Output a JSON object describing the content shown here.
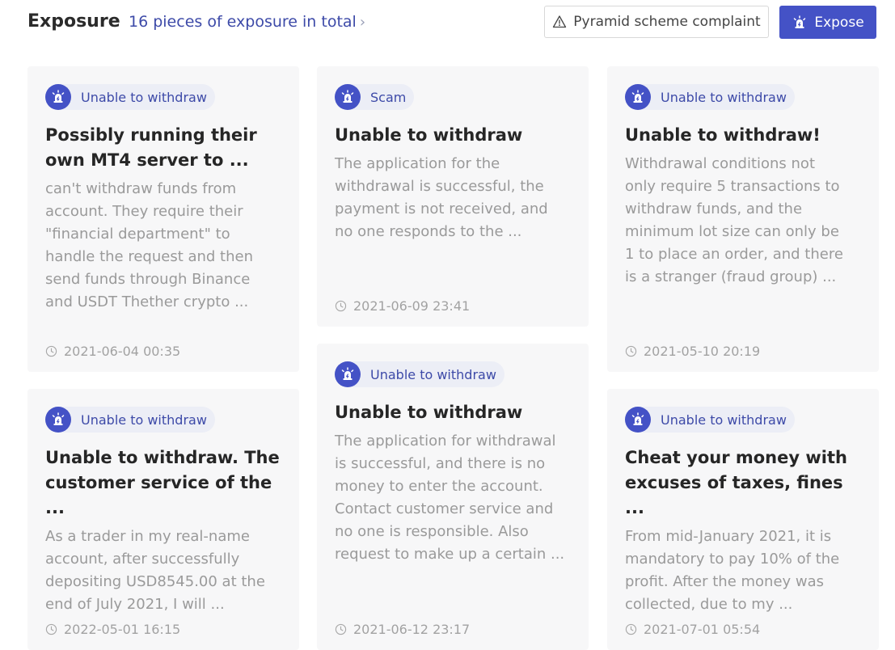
{
  "header": {
    "title": "Exposure",
    "total_link": "16 pieces of exposure in total",
    "chevron_icon": "chevron-right-icon",
    "complaint_button": "Pyramid scheme complaint",
    "complaint_icon": "warning-triangle-icon",
    "expose_button": "Expose",
    "expose_icon": "alarm-icon"
  },
  "colors": {
    "accent": "#4452c6",
    "tag_background": "#eceef6",
    "card_background": "#f7f7f8",
    "body_text": "#9a9a9a"
  },
  "cards": [
    {
      "tag": "Unable to withdraw",
      "title_lines": [
        "Possibly running their",
        "own MT4 server to ..."
      ],
      "body_lines": [
        "can't withdraw funds from",
        "account. They require their",
        "\"financial department\" to",
        "handle the request and then",
        "send funds through Binance",
        "and USDT Thether crypto ..."
      ],
      "time": "2021-06-04 00:35"
    },
    {
      "tag": "Scam",
      "title_lines": [
        "Unable to withdraw"
      ],
      "body_lines": [
        "The application for the",
        "withdrawal is successful, the",
        "payment is not received, and",
        "no one responds to the ..."
      ],
      "time": "2021-06-09 23:41"
    },
    {
      "tag": "Unable to withdraw",
      "title_lines": [
        "Unable to withdraw!"
      ],
      "body_lines": [
        "Withdrawal conditions not",
        "only require 5 transactions to",
        "withdraw funds, and the",
        "minimum lot size can only be",
        "1 to place an order, and there",
        "is a stranger (fraud group) ..."
      ],
      "time": "2021-05-10 20:19"
    },
    {
      "tag": "Unable to withdraw",
      "title_lines": [
        "Unable to withdraw. The",
        "customer service of the ..."
      ],
      "body_lines": [
        "As a trader in my real-name",
        "account, after successfully",
        "depositing USD8545.00 at the",
        "end of July 2021, I will ..."
      ],
      "time": "2022-05-01 16:15"
    },
    {
      "tag": "Unable to withdraw",
      "title_lines": [
        "Unable to withdraw"
      ],
      "body_lines": [
        "The application for withdrawal",
        "is successful, and there is no",
        "money to enter the account.",
        "Contact customer service and",
        "no one is responsible. Also",
        "request to make up a certain ..."
      ],
      "time": "2021-06-12 23:17"
    },
    {
      "tag": "Unable to withdraw",
      "title_lines": [
        "Cheat your money with",
        "excuses of taxes, fines ..."
      ],
      "body_lines": [
        "From mid-January 2021, it is",
        "mandatory to pay 10% of the",
        "profit. After the money was",
        "collected, due to my ..."
      ],
      "time": "2021-07-01 05:54"
    }
  ]
}
